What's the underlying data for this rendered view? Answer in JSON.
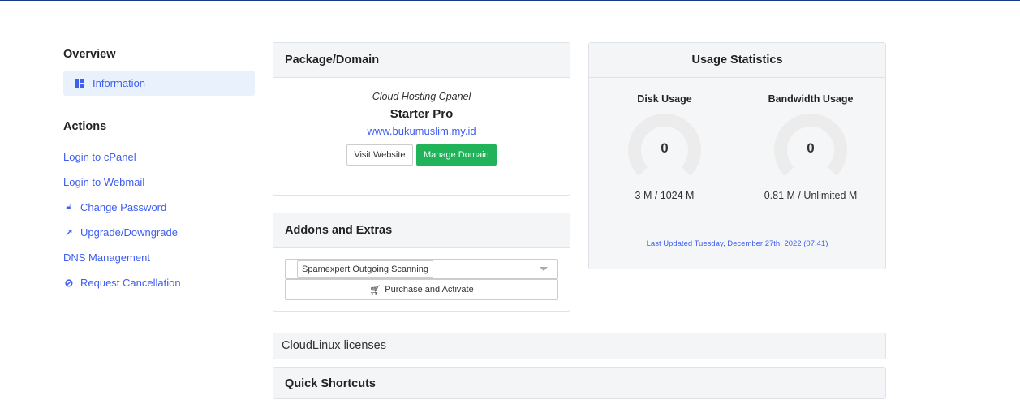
{
  "sidebar": {
    "overview_title": "Overview",
    "active_item": "Information",
    "actions_title": "Actions",
    "actions": [
      {
        "label": "Login to cPanel",
        "icon": ""
      },
      {
        "label": "Login to Webmail",
        "icon": ""
      },
      {
        "label": "Change Password",
        "icon": "lock-icon"
      },
      {
        "label": "Upgrade/Downgrade",
        "icon": "external-link-icon"
      },
      {
        "label": "DNS Management",
        "icon": ""
      },
      {
        "label": "Request Cancellation",
        "icon": "ban-icon"
      }
    ]
  },
  "package": {
    "title": "Package/Domain",
    "group": "Cloud Hosting Cpanel",
    "name": "Starter Pro",
    "domain": "www.bukumuslim.my.id",
    "visit_label": "Visit Website",
    "manage_label": "Manage Domain"
  },
  "addons": {
    "title": "Addons and Extras",
    "selected": "Spamexpert Outgoing Scanning",
    "purchase_label": "Purchase and Activate"
  },
  "usage": {
    "title": "Usage Statistics",
    "disk": {
      "label": "Disk Usage",
      "value": "0",
      "detail": "3 M / 1024 M",
      "percent": 0
    },
    "bandwidth": {
      "label": "Bandwidth Usage",
      "value": "0",
      "detail": "0.81 M / Unlimited M",
      "percent": 0
    },
    "updated": "Last Updated Tuesday, December 27th, 2022 (07:41)"
  },
  "cloudlinux": {
    "title": "CloudLinux licenses"
  },
  "shortcuts": {
    "title": "Quick Shortcuts"
  },
  "colors": {
    "accent": "#3e5ef0",
    "success": "#21b35a"
  }
}
